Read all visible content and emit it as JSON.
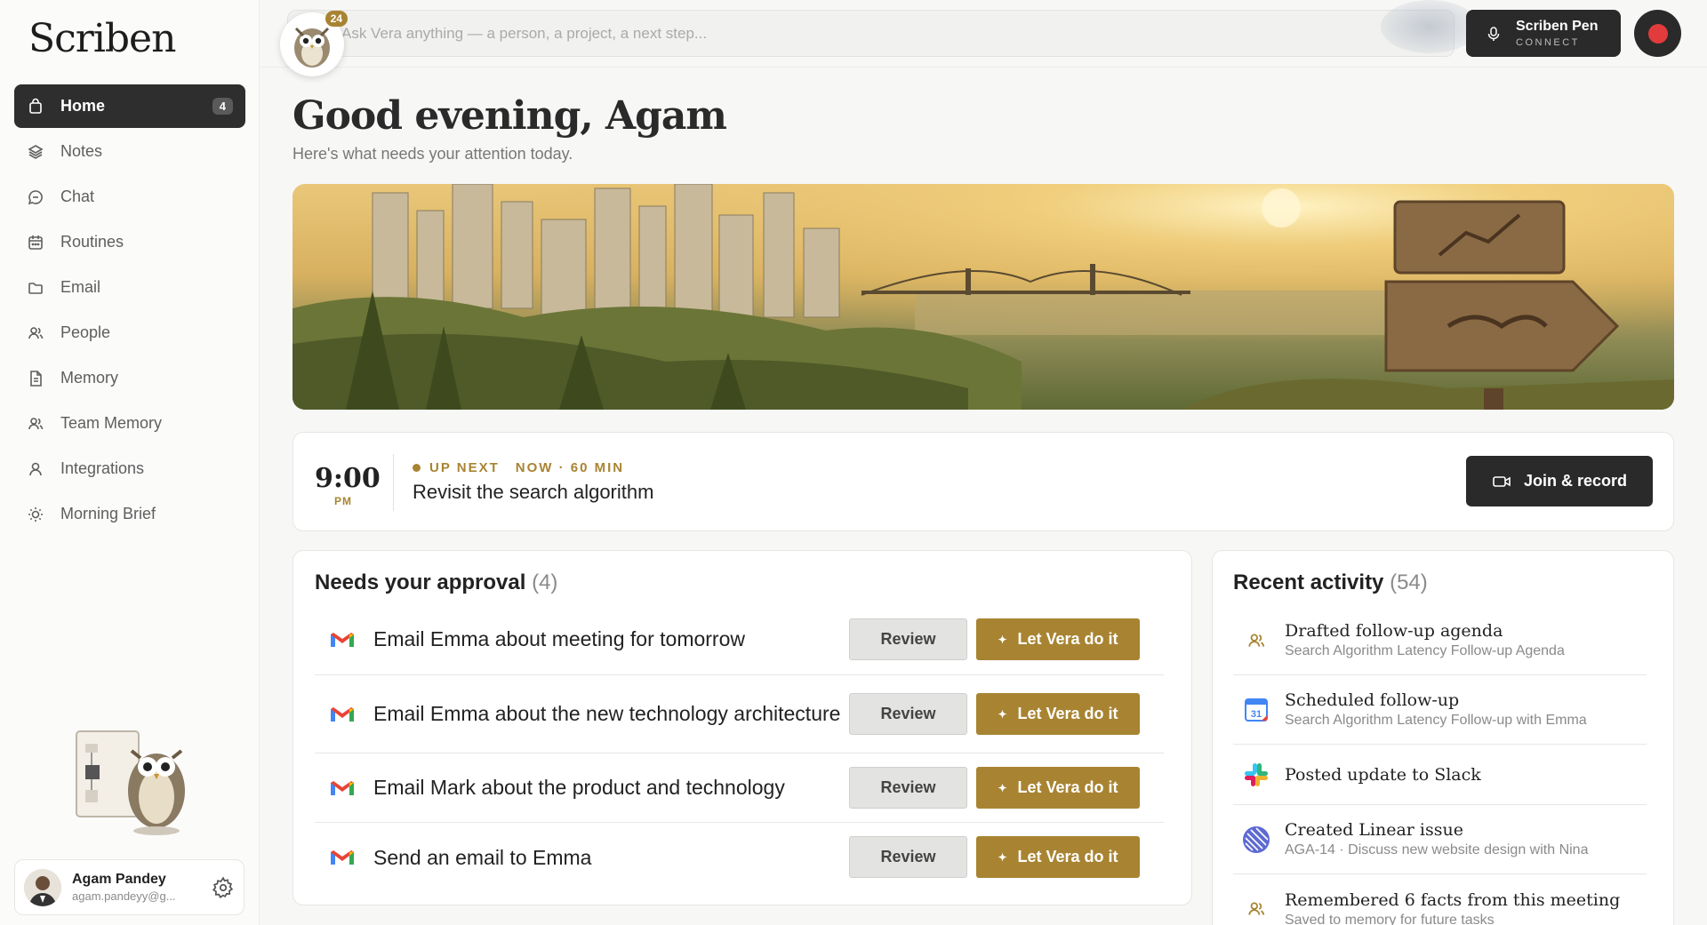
{
  "app": {
    "logo": "Scriben"
  },
  "sidebar": {
    "items": [
      {
        "label": "Home",
        "badge": "4",
        "icon": "home-icon"
      },
      {
        "label": "Notes",
        "icon": "layers-icon"
      },
      {
        "label": "Chat",
        "icon": "chat-icon"
      },
      {
        "label": "Routines",
        "icon": "calendar-icon"
      },
      {
        "label": "Email",
        "icon": "folder-icon"
      },
      {
        "label": "People",
        "icon": "people-icon"
      },
      {
        "label": "Memory",
        "icon": "document-icon"
      },
      {
        "label": "Team Memory",
        "icon": "team-icon"
      },
      {
        "label": "Integrations",
        "icon": "person-icon"
      },
      {
        "label": "Morning Brief",
        "icon": "sun-icon"
      }
    ]
  },
  "user": {
    "name": "Agam Pandey",
    "email": "agam.pandeyy@g..."
  },
  "topbar": {
    "search_placeholder": "Ask Vera anything — a person, a project, a next step...",
    "vera_badge": "24",
    "pen_title": "Scriben Pen",
    "pen_sub": "CONNECT"
  },
  "greeting": {
    "title": "Good evening, Agam",
    "subtitle": "Here's what needs your attention today."
  },
  "upnext": {
    "time": "9:00",
    "ampm": "PM",
    "label": "UP NEXT",
    "meta": "NOW · 60 MIN",
    "title": "Revisit the search algorithm",
    "join_label": "Join & record"
  },
  "approval": {
    "title": "Needs your approval",
    "count": "(4)",
    "review_label": "Review",
    "vera_label": "Let Vera do it",
    "items": [
      {
        "text": "Email Emma about meeting for tomorrow"
      },
      {
        "text": "Email Emma about the new technology architecture"
      },
      {
        "text": "Email Mark about the product and technology"
      },
      {
        "text": "Send an email to Emma"
      }
    ]
  },
  "activity": {
    "title": "Recent activity",
    "count": "(54)",
    "items": [
      {
        "title": "Drafted follow-up agenda",
        "sub": "Search Algorithm Latency Follow-up Agenda",
        "icon": "people-icon"
      },
      {
        "title": "Scheduled follow-up",
        "sub": "Search Algorithm Latency Follow-up with Emma",
        "icon": "google-calendar-icon",
        "cal_day": "31"
      },
      {
        "title": "Posted update to Slack",
        "sub": "",
        "icon": "slack-icon"
      },
      {
        "title": "Created Linear issue",
        "sub": "AGA-14 · Discuss new website design with Nina",
        "icon": "linear-icon"
      },
      {
        "title": "Remembered 6 facts from this meeting",
        "sub": "Saved to memory for future tasks",
        "icon": "people-icon"
      }
    ]
  },
  "colors": {
    "accent_gold": "#a88432",
    "dark": "#2a2a2a",
    "record_red": "#e23b3b"
  }
}
